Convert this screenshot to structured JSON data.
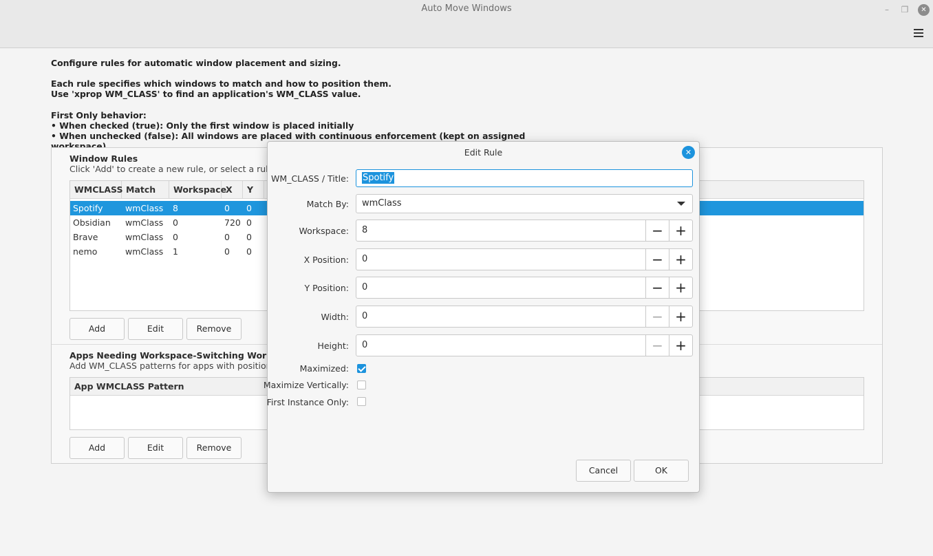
{
  "window": {
    "title": "Auto Move Windows"
  },
  "info": {
    "line1": "Configure rules for automatic window placement and sizing.",
    "line2": "Each rule specifies which windows to match and how to position them.",
    "line3": "Use 'xprop WM_CLASS' to find an application's WM_CLASS value.",
    "line4": "First Only behavior:",
    "line5": "• When checked (true): Only the first window is placed initially",
    "line6": "• When unchecked (false): All windows are placed with continuous enforcement (kept on assigned workspace)"
  },
  "rules_section": {
    "title": "Window Rules",
    "subtitle": "Click 'Add' to create a new rule, or select a rule and c",
    "columns": [
      "WMCLASS",
      "Match By",
      "Workspace",
      "X",
      "Y"
    ],
    "rows": [
      [
        "Spotify",
        "wmClass",
        "8",
        "0",
        "0"
      ],
      [
        "Obsidian",
        "wmClass",
        "0",
        "720",
        "0"
      ],
      [
        "Brave",
        "wmClass",
        "0",
        "0",
        "0"
      ],
      [
        "nemo",
        "wmClass",
        "1",
        "0",
        "0"
      ]
    ],
    "add": "Add",
    "edit": "Edit",
    "remove": "Remove"
  },
  "workaround_section": {
    "title": "Apps Needing Workspace-Switching Workaround",
    "subtitle": "Add WM_CLASS patterns for apps with positioning",
    "column": "App WMCLASS Pattern",
    "add": "Add",
    "edit": "Edit",
    "remove": "Remove"
  },
  "dialog": {
    "title": "Edit Rule",
    "wmclass_label": "WM_CLASS / Title:",
    "wmclass_value": "Spotify",
    "matchby_label": "Match By:",
    "matchby_value": "wmClass",
    "workspace_label": "Workspace:",
    "workspace_value": "8",
    "x_label": "X Position:",
    "x_value": "0",
    "y_label": "Y Position:",
    "y_value": "0",
    "width_label": "Width:",
    "width_value": "0",
    "height_label": "Height:",
    "height_value": "0",
    "maximized_label": "Maximized:",
    "maxvert_label": "Maximize Vertically:",
    "firstonly_label": "First Instance Only:",
    "cancel": "Cancel",
    "ok": "OK",
    "maximized": true,
    "maximize_vertically": false,
    "first_instance_only": false
  },
  "colors": {
    "accent": "#1c93dd",
    "selection": "#1f96dd"
  }
}
